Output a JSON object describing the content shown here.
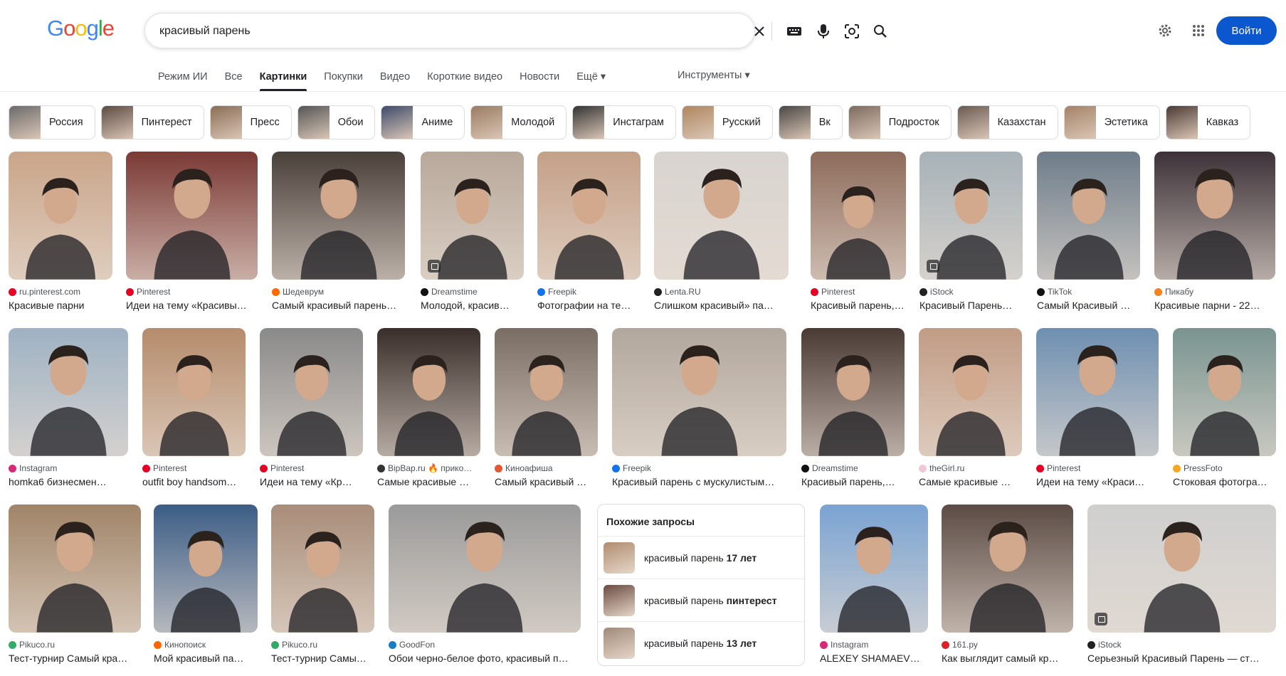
{
  "header": {
    "logo": [
      "G",
      "o",
      "o",
      "g",
      "l",
      "e"
    ],
    "logo_colors": [
      "#4285f4",
      "#ea4335",
      "#fbbc05",
      "#4285f4",
      "#34a853",
      "#ea4335"
    ],
    "search_value": "красивый парень",
    "login_label": "Войти"
  },
  "tabs": [
    "Режим ИИ",
    "Все",
    "Картинки",
    "Покупки",
    "Видео",
    "Короткие видео",
    "Новости",
    "Ещё ▾"
  ],
  "tools_label": "Инструменты ▾",
  "chips": [
    {
      "label": "Россия",
      "tone": "#6b6a6a"
    },
    {
      "label": "Пинтерест",
      "tone": "#5c4a42"
    },
    {
      "label": "Пресс",
      "tone": "#8a6d55"
    },
    {
      "label": "Обои",
      "tone": "#555"
    },
    {
      "label": "Аниме",
      "tone": "#3e4a6b"
    },
    {
      "label": "Молодой",
      "tone": "#9a7b61"
    },
    {
      "label": "Инстаграм",
      "tone": "#333"
    },
    {
      "label": "Русский",
      "tone": "#b0865f"
    },
    {
      "label": "Вк",
      "tone": "#4a4644"
    },
    {
      "label": "Подросток",
      "tone": "#7d6a5e"
    },
    {
      "label": "Казахстан",
      "tone": "#6a5a52"
    },
    {
      "label": "Эстетика",
      "tone": "#a48367"
    },
    {
      "label": "Кавказ",
      "tone": "#4b3a35"
    }
  ],
  "images": [
    {
      "source": "ru.pinterest.com",
      "title": "Красивые парни",
      "fav": "#e60023",
      "bg": "#c9a58a"
    },
    {
      "source": "Pinterest",
      "title": "Идеи на тему «Красивы…",
      "fav": "#e60023",
      "bg": "#7b3a35"
    },
    {
      "source": "Шедеврум",
      "title": "Самый красивый парень…",
      "fav": "#ff6a00",
      "bg": "#4a403a"
    },
    {
      "source": "Dreamstime",
      "title": "Молодой, красив…",
      "fav": "#111",
      "bg": "#b7a89a"
    },
    {
      "source": "Freepik",
      "title": "Фотографии на те…",
      "fav": "#1273eb",
      "bg": "#c4a088"
    },
    {
      "source": "Lenta.RU",
      "title": "Слишком красивый» па…",
      "fav": "#222",
      "bg": "#d8d4d0"
    },
    {
      "source": "Pinterest",
      "title": "Красивый парень,…",
      "fav": "#e60023",
      "bg": "#8d6b5b"
    },
    {
      "source": "iStock",
      "title": "Красивый Парень…",
      "fav": "#222",
      "bg": "#a7b2b8"
    },
    {
      "source": "TikTok",
      "title": "Самый Красивый …",
      "fav": "#111",
      "bg": "#6e7d8a"
    },
    {
      "source": "Пикабу",
      "title": "Красивые парни - 22…",
      "fav": "#f5821f",
      "bg": "#3d3238"
    },
    {
      "source": "Instagram",
      "title": "homka6 бизнесмен…",
      "fav": "#d62976",
      "bg": "#9fb2c3"
    },
    {
      "source": "Pinterest",
      "title": "outfit boy handsom…",
      "fav": "#e60023",
      "bg": "#b58c6c"
    },
    {
      "source": "Pinterest",
      "title": "Идеи на тему «Кр…",
      "fav": "#e60023",
      "bg": "#8a8a8a"
    },
    {
      "source": "BipBap.ru 🔥 прико…",
      "title": "Самые красивые …",
      "fav": "#333",
      "bg": "#3a2e2a"
    },
    {
      "source": "Киноафиша",
      "title": "Самый красивый …",
      "fav": "#e8542c",
      "bg": "#7a6d64"
    },
    {
      "source": "Freepik",
      "title": "Красивый парень с мускулистым…",
      "fav": "#1273eb",
      "bg": "#b2a79d"
    },
    {
      "source": "Dreamstime",
      "title": "Красивый парень,…",
      "fav": "#111",
      "bg": "#4a3a34"
    },
    {
      "source": "theGirl.ru",
      "title": "Самые красивые …",
      "fav": "#f0c6d8",
      "bg": "#c19c85"
    },
    {
      "source": "Pinterest",
      "title": "Идеи на тему «Краси…",
      "fav": "#e60023",
      "bg": "#6e8fb0"
    },
    {
      "source": "PressFoto",
      "title": "Стоковая фотогра…",
      "fav": "#f5a623",
      "bg": "#7a9490"
    },
    {
      "source": "Pikuco.ru",
      "title": "Тест-турнир Самый кра…",
      "fav": "#3a6",
      "bg": "#a08468"
    },
    {
      "source": "Кинопоиск",
      "title": "Мой красивый па…",
      "fav": "#f60",
      "bg": "#3c5d86"
    },
    {
      "source": "Pikuco.ru",
      "title": "Тест-турнир Самы…",
      "fav": "#3a6",
      "bg": "#a88d79"
    },
    {
      "source": "GoodFon",
      "title": "Обои черно-белое фото, красивый п…",
      "fav": "#1a7cc2",
      "bg": "#9a9a9a"
    },
    {
      "source": "Instagram",
      "title": "ALEXEY SHAMAEV…",
      "fav": "#d62976",
      "bg": "#7aa3d2"
    },
    {
      "source": "161.ру",
      "title": "Как выглядит самый кр…",
      "fav": "#e0212a",
      "bg": "#5b4b44"
    },
    {
      "source": "iStock",
      "title": "Серьезный Красивый Парень — ст…",
      "fav": "#222",
      "bg": "#cfcfcf"
    }
  ],
  "related": {
    "title": "Похожие запросы",
    "items": [
      {
        "prefix": "красивый парень ",
        "bold": "17 лет",
        "tone": "#b08c70"
      },
      {
        "prefix": "красивый парень ",
        "bold": "пинтерест",
        "tone": "#6b4b42"
      },
      {
        "prefix": "красивый парень ",
        "bold": "13 лет",
        "tone": "#a08a7a"
      }
    ]
  }
}
